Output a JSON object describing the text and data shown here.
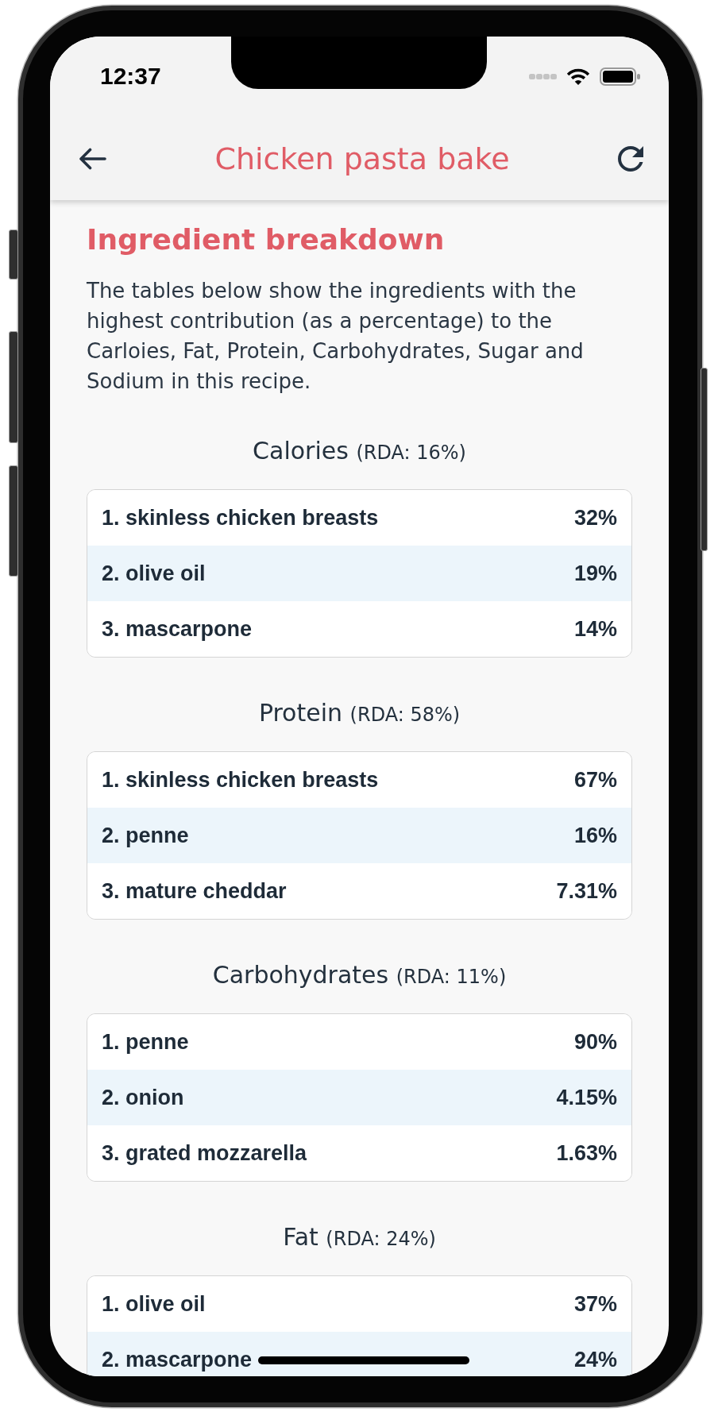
{
  "status_bar": {
    "time": "12:37"
  },
  "header": {
    "title": "Chicken pasta bake"
  },
  "intro": {
    "heading": "Ingredient breakdown",
    "text": "The tables below show the ingredients with the highest contribution (as a percentage) to the Carloies, Fat, Protein, Carbohydrates, Sugar and Sodium in this recipe."
  },
  "tables": [
    {
      "nutrient": "Calories",
      "rda": "(RDA: 16%)",
      "rows": [
        {
          "ingredient": "1. skinless chicken breasts",
          "percentage": "32%"
        },
        {
          "ingredient": "2. olive oil",
          "percentage": "19%"
        },
        {
          "ingredient": "3. mascarpone",
          "percentage": "14%"
        }
      ]
    },
    {
      "nutrient": "Protein",
      "rda": "(RDA: 58%)",
      "rows": [
        {
          "ingredient": "1. skinless chicken breasts",
          "percentage": "67%"
        },
        {
          "ingredient": "2. penne",
          "percentage": "16%"
        },
        {
          "ingredient": "3. mature cheddar",
          "percentage": "7.31%"
        }
      ]
    },
    {
      "nutrient": "Carbohydrates",
      "rda": "(RDA: 11%)",
      "rows": [
        {
          "ingredient": "1. penne",
          "percentage": "90%"
        },
        {
          "ingredient": "2. onion",
          "percentage": "4.15%"
        },
        {
          "ingredient": "3. grated mozzarella",
          "percentage": "1.63%"
        }
      ]
    },
    {
      "nutrient": "Fat",
      "rda": "(RDA: 24%)",
      "rows": [
        {
          "ingredient": "1. olive oil",
          "percentage": "37%"
        },
        {
          "ingredient": "2. mascarpone",
          "percentage": "24%"
        }
      ]
    }
  ]
}
